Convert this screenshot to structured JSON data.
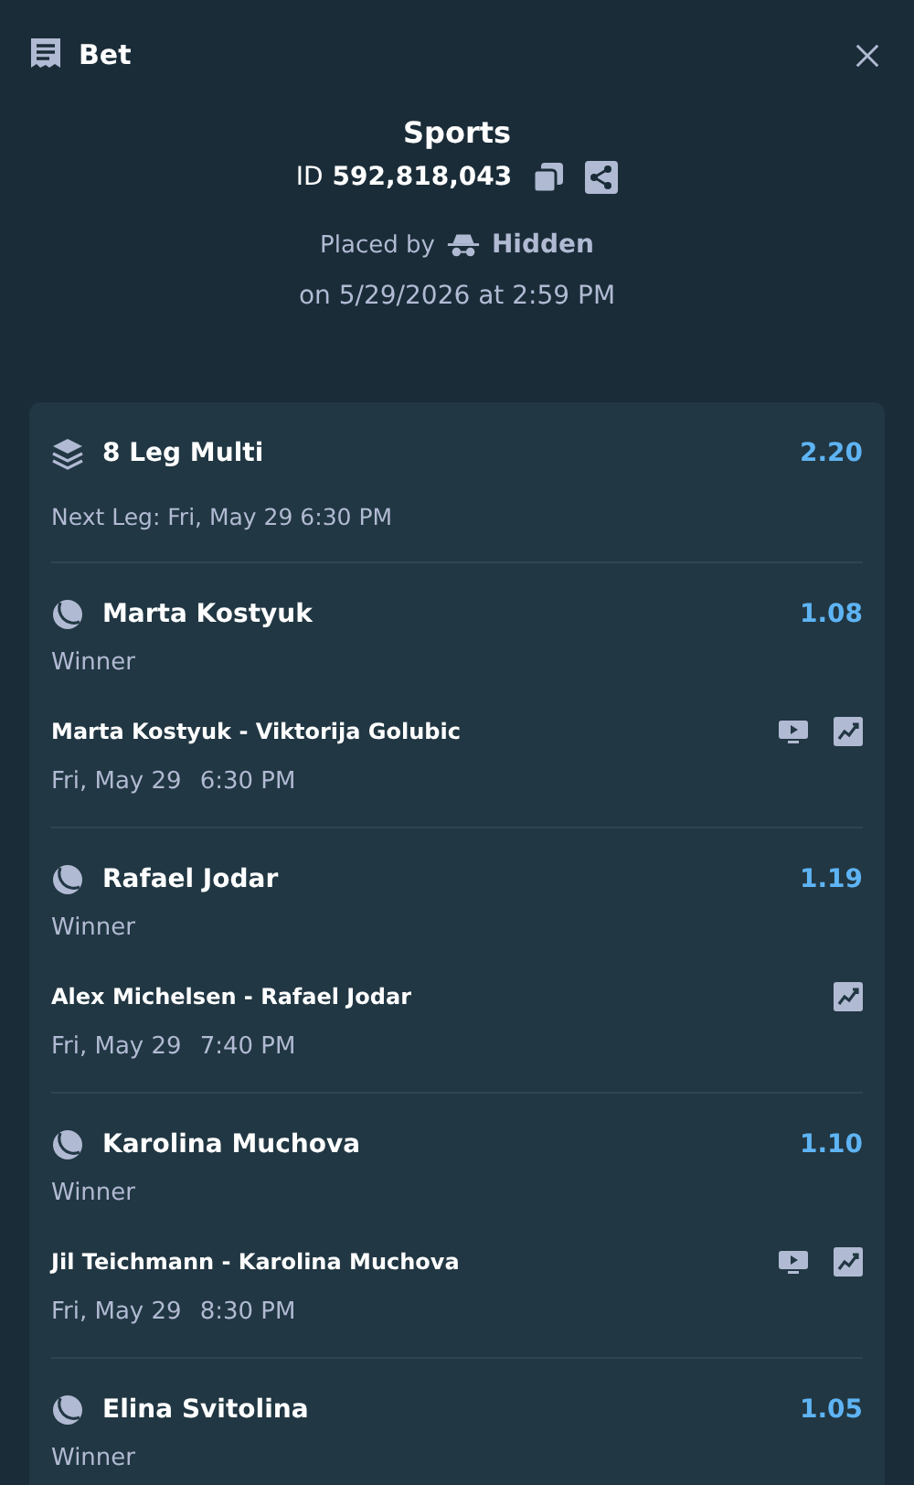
{
  "header": {
    "title": "Bet"
  },
  "bet": {
    "category": "Sports",
    "id_label": "ID",
    "id": "592,818,043",
    "placed_by_label": "Placed by",
    "placed_by": "Hidden",
    "placed_on": "on 5/29/2026 at 2:59 PM"
  },
  "multi": {
    "title": "8 Leg Multi",
    "odds": "2.20",
    "next_leg": "Next Leg: Fri, May 29 6:30 PM"
  },
  "legs": [
    {
      "selection": "Marta Kostyuk",
      "odds": "1.08",
      "market": "Winner",
      "match": "Marta Kostyuk - Viktorija Golubic",
      "date": "Fri, May 29",
      "time": "6:30 PM",
      "stream": true,
      "stats": true
    },
    {
      "selection": "Rafael Jodar",
      "odds": "1.19",
      "market": "Winner",
      "match": "Alex Michelsen - Rafael Jodar",
      "date": "Fri, May 29",
      "time": "7:40 PM",
      "stream": false,
      "stats": true
    },
    {
      "selection": "Karolina Muchova",
      "odds": "1.10",
      "market": "Winner",
      "match": "Jil Teichmann - Karolina Muchova",
      "date": "Fri, May 29",
      "time": "8:30 PM",
      "stream": true,
      "stats": true
    },
    {
      "selection": "Elina Svitolina",
      "odds": "1.05",
      "market": "Winner"
    }
  ]
}
